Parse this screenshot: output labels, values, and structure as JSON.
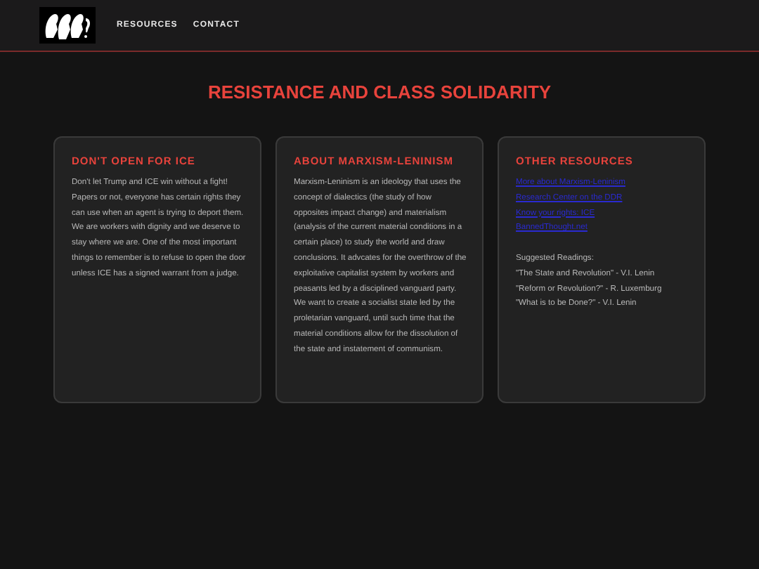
{
  "nav": {
    "links": [
      "RESOURCES",
      "CONTACT"
    ]
  },
  "title": "RESISTANCE AND CLASS SOLIDARITY",
  "cards": [
    {
      "kind": "text",
      "heading": "DON'T OPEN FOR ICE",
      "body": "Don't let Trump and ICE win without a fight! Papers or not, everyone has certain rights they can use when an agent is trying to deport them. We are workers with dignity and we deserve to stay where we are. One of the most important things to remember is to refuse to open the door unless ICE has a signed warrant from a judge."
    },
    {
      "kind": "text",
      "heading": "ABOUT MARXISM-LENINISM",
      "body": "Marxism-Leninism is an ideology that uses the concept of dialectics (the study of how opposites impact change) and materialism (analysis of the current material conditions in a certain place) to study the world and draw conclusions. It advcates for the overthrow of the exploitative capitalist system by workers and peasants led by a disciplined vanguard party. We want to create a socialist state led by the proletarian vanguard, until such time that the material conditions allow for the dissolution of the state and instatement of communism."
    },
    {
      "kind": "links",
      "heading": "OTHER RESOURCES",
      "links": [
        "More about Marxism-Leninism",
        "Research Center on the DDR",
        "Know your rights: ICE",
        "BannedThought.net"
      ],
      "readings_heading": "Suggested Readings:",
      "readings": [
        "\"The State and Revolution\" - V.I. Lenin",
        "\"Reform or Revolution?\" - R. Luxemburg",
        "\"What is to be Done?\" - V.I. Lenin"
      ]
    }
  ]
}
